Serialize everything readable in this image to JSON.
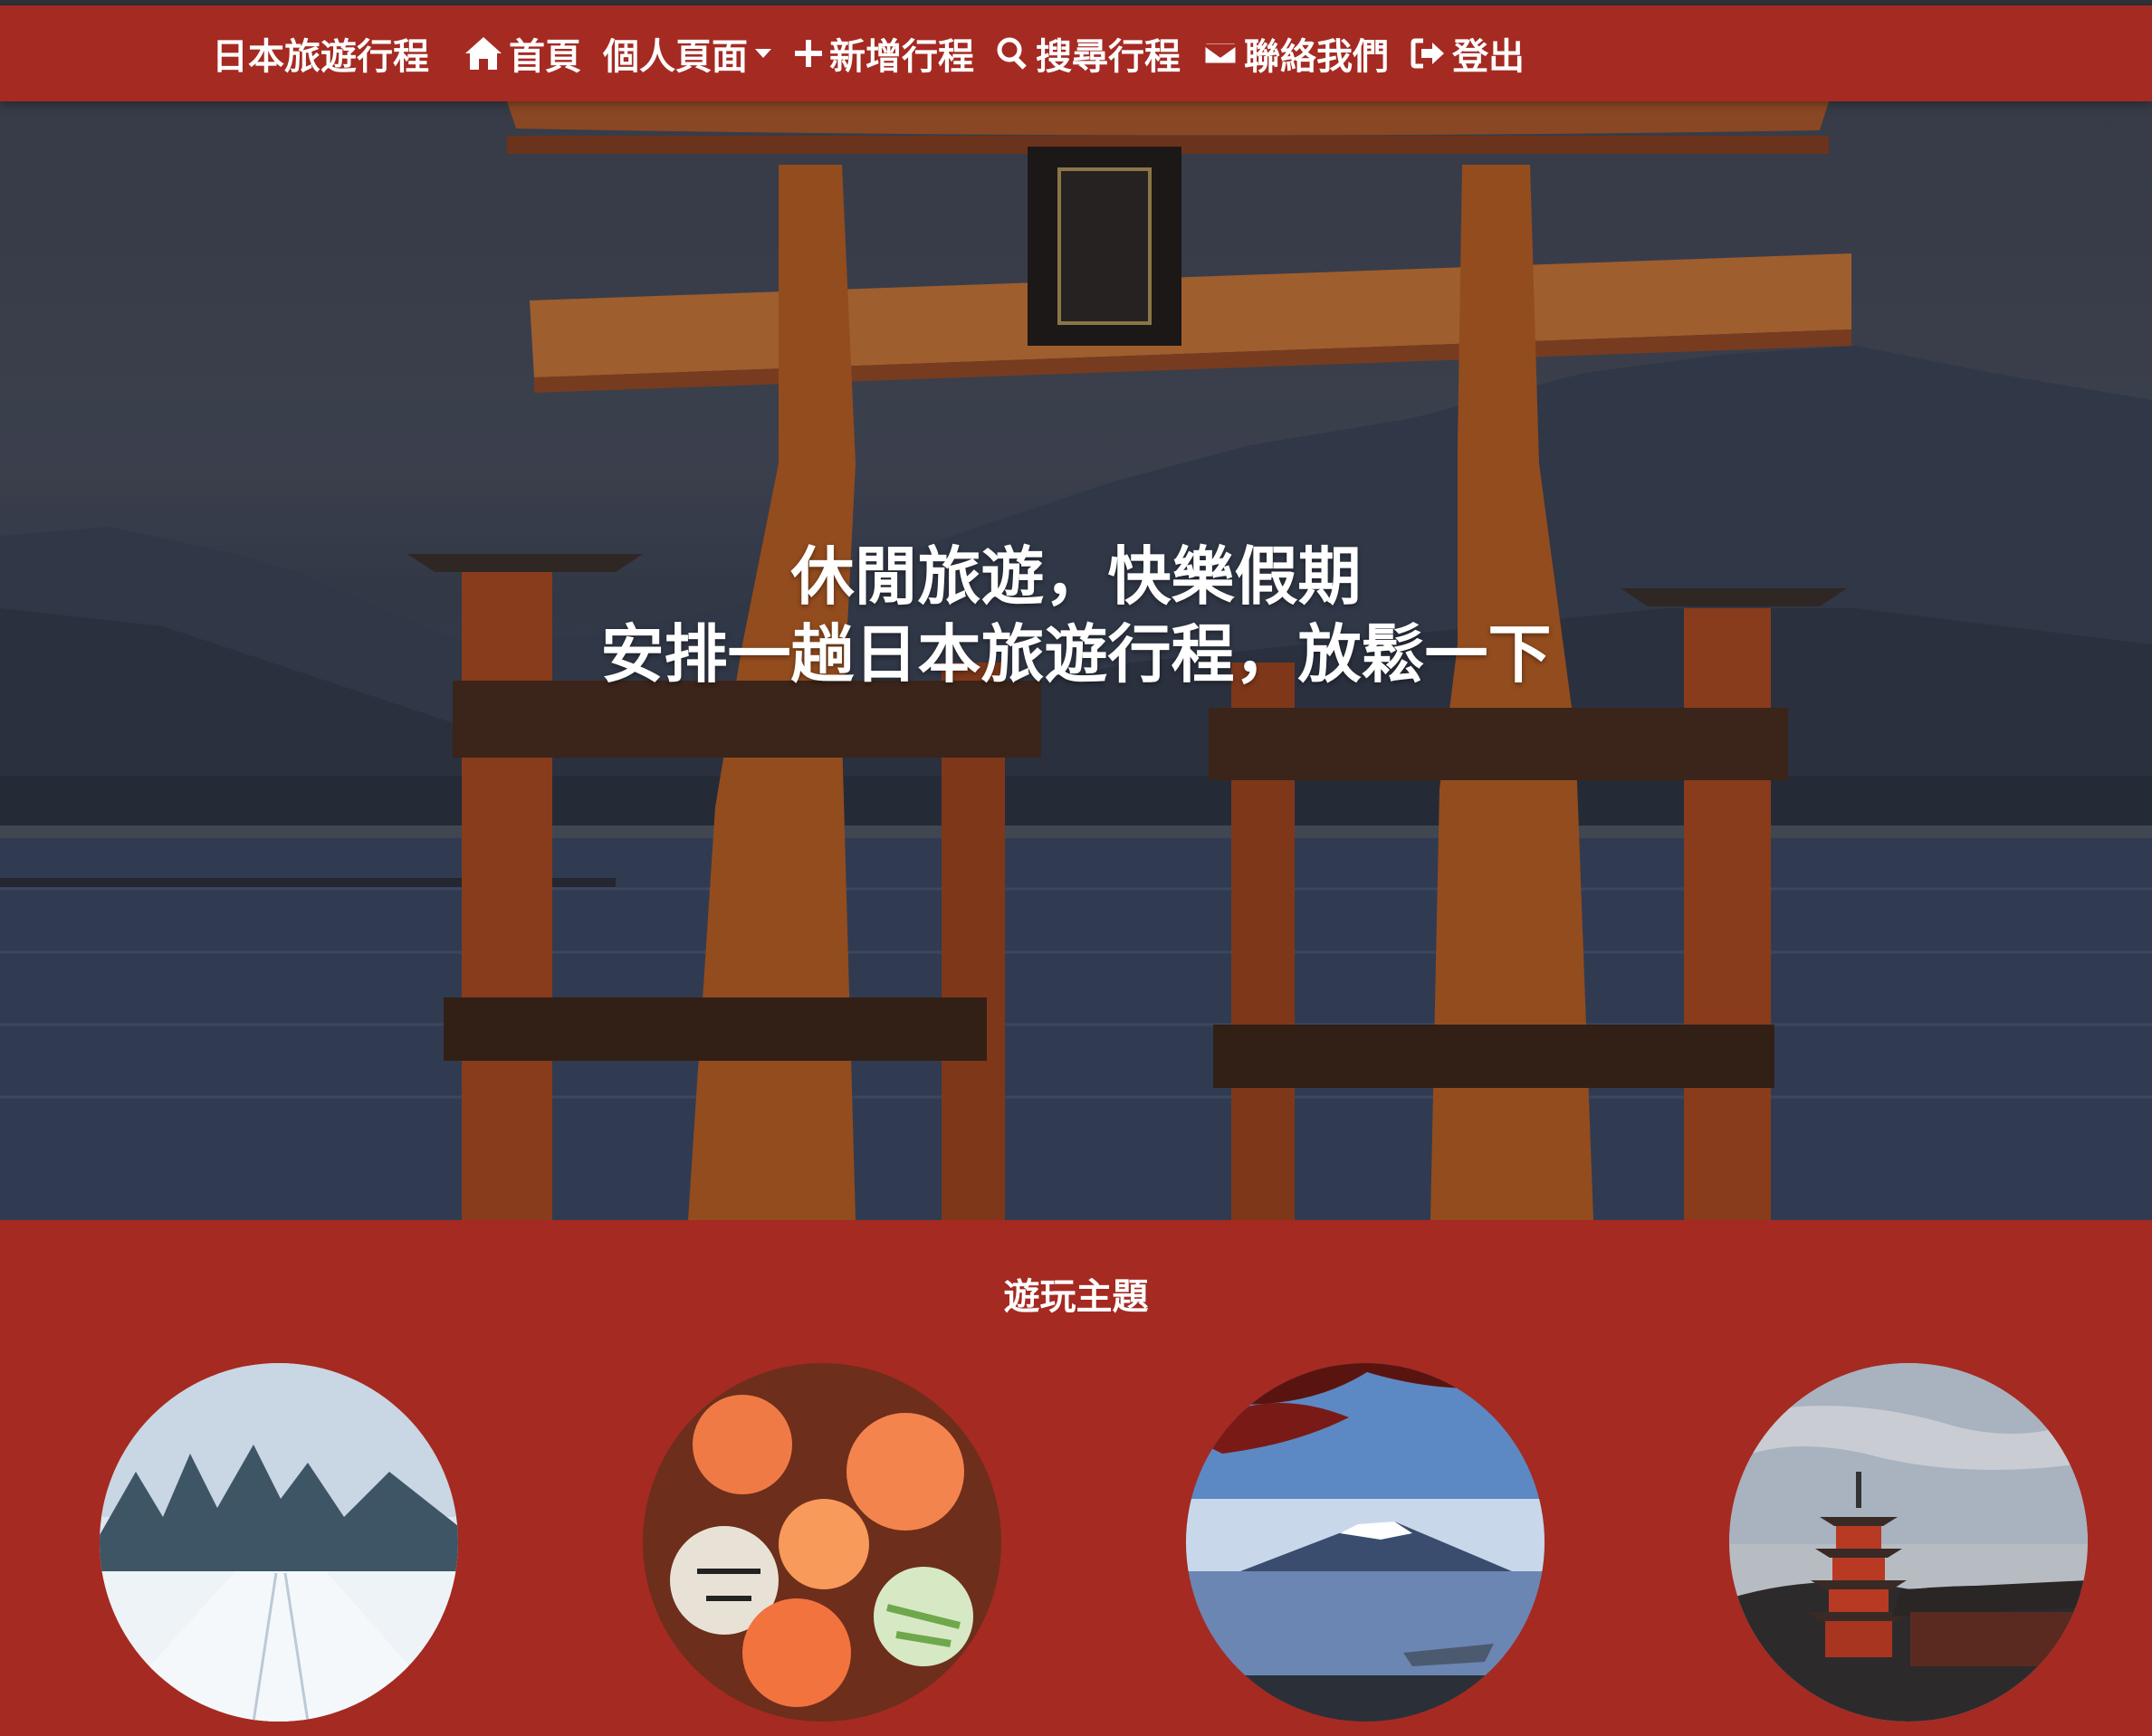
{
  "nav": {
    "brand": "日本旅遊行程",
    "home": "首頁",
    "profile": "個人頁面",
    "add_trip": "新增行程",
    "search_trip": "搜尋行程",
    "contact": "聯絡我們",
    "logout": "登出"
  },
  "hero": {
    "line1": "休閒旅遊，快樂假期",
    "line2": "安排一趟日本旅遊行程，放鬆一下"
  },
  "themes": {
    "title": "遊玩主題",
    "items": [
      "snow-road",
      "sushi-platter",
      "mount-fuji",
      "pagoda-temple"
    ]
  },
  "colors": {
    "brand": "#a52a22",
    "nav_text": "#ffffff"
  },
  "icons": [
    "home-icon",
    "plus-icon",
    "search-icon",
    "envelope-icon",
    "sign-out-icon",
    "chevron-down-icon"
  ]
}
